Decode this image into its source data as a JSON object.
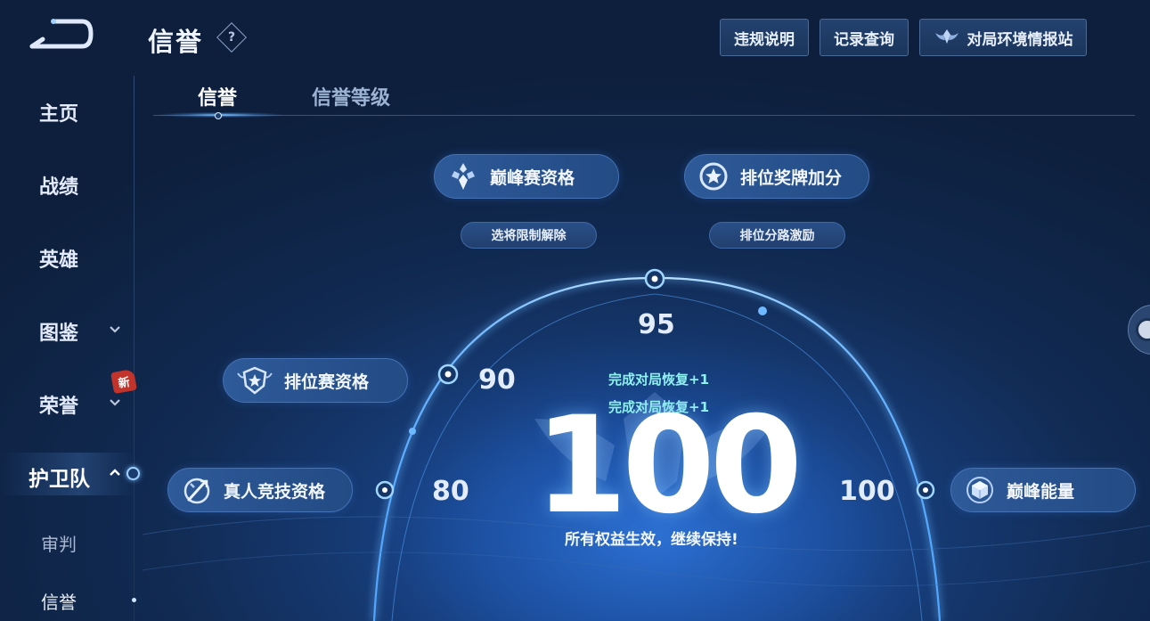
{
  "header": {
    "title": "信誉",
    "help_label": "?",
    "buttons": {
      "violation": "违规说明",
      "records": "记录查询",
      "environment": "对局环境情报站"
    }
  },
  "sidebar": {
    "items": [
      {
        "label": "主页"
      },
      {
        "label": "战绩"
      },
      {
        "label": "英雄"
      },
      {
        "label": "图鉴"
      },
      {
        "label": "荣誉",
        "badge": "新"
      },
      {
        "label": "护卫队"
      }
    ],
    "sub_items": [
      {
        "label": "审判"
      },
      {
        "label": "信誉"
      }
    ]
  },
  "tabs": [
    {
      "label": "信誉",
      "active": true
    },
    {
      "label": "信誉等级",
      "active": false
    }
  ],
  "tiers": {
    "peak_qualification": {
      "label": "巅峰赛资格",
      "icon": "peak-crystal-icon"
    },
    "medal_bonus": {
      "label": "排位奖牌加分",
      "icon": "star-medal-icon"
    },
    "ranked_qualification": {
      "label": "排位赛资格",
      "icon": "shield-star-icon"
    },
    "human_match_qualification": {
      "label": "真人竞技资格",
      "icon": "sword-circle-icon"
    },
    "peak_energy": {
      "label": "巅峰能量",
      "icon": "energy-cube-icon"
    },
    "sub_unlock": "选将限制解除",
    "sub_lane": "排位分路激励"
  },
  "scale": {
    "marks": [
      "80",
      "90",
      "95",
      "100"
    ]
  },
  "score": {
    "value": "100",
    "recover_lines": [
      "完成对局恢复+1",
      "完成对局恢复+1"
    ],
    "status": "所有权益生效，继续保持!"
  },
  "colors": {
    "accent": "#7ec3ff",
    "recover_text": "#8ff0f0",
    "badge": "#c2332c"
  }
}
